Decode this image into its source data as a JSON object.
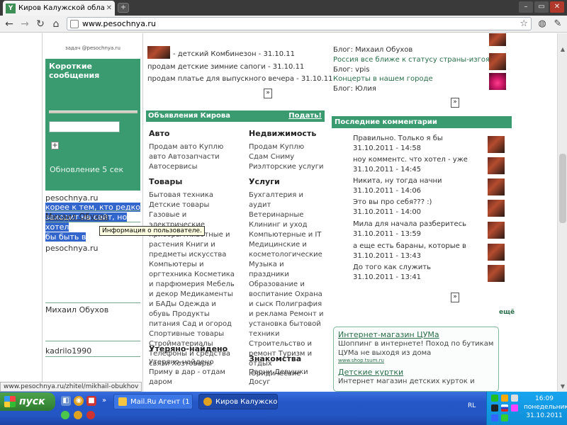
{
  "browser": {
    "tab_title": "Киров Калужской области го",
    "tab_favicon": "Y",
    "url": "www.pesochnya.ru",
    "status_url": "www.pesochnya.ru/zhitel/mikhail-obukhov"
  },
  "left": {
    "tiny_top": "задач @pesochnya.ru",
    "short_messages": {
      "title": "Короткие сообщения",
      "update_text": "Обновление 5 сек"
    },
    "site_name": "pesochnya.ru",
    "selected_lines": [
      "корее к тем, кто редко",
      "заходит на сайт, но хотел",
      "бы быть в"
    ],
    "users": [
      {
        "name": "Михаил Обухов"
      },
      {
        "name": "pesochnya.ru"
      },
      {
        "name": "Михаил Обухов"
      },
      {
        "name": "kadrilo1990"
      }
    ],
    "tooltip": "Информация о пользователе."
  },
  "middle": {
    "news": [
      "- детский Комбинезон - 31.10.11",
      "продам детские зимние сапоги - 31.10.11",
      "продам платье для выпускного вечера - 31.10.11"
    ],
    "pager": "»",
    "ads_header": "Объявления Кирова",
    "ads_post": "Подать!",
    "categories": {
      "auto": {
        "title": "Авто",
        "text": "Продам авто Куплю авто Автозапчасти Автосервисы"
      },
      "realty": {
        "title": "Недвижимость",
        "text": "Продам Куплю Сдам Сниму Риэлторские услуги"
      },
      "goods": {
        "title": "Товары",
        "text": "Бытовая техника Детские товары Газовые и электрические приборы Животные и растения Книги и предметы искусства Компьютеры и оргтехника Косметика и парфюмерия Мебель и декор Медикаменты и БАДы Одежда и обувь Продукты питания Сад и огород Спортивные товары Стройматериалы Телефоны и средства связи Хозтовары"
      },
      "services": {
        "title": "Услуги",
        "text": "Бухгалтерия и аудит Ветеринарные Клининг и уход Компьютерные и IT Медицинские и косметологические Музыка и праздники Образование и воспитание Охрана и сыск Полиграфия и реклама Ремонт и установка бытовой техники Строительство и ремонт Туризм и отдых Юридические"
      },
      "lost": {
        "title": "Утеряно-найдено",
        "text": "Утеряно-найдено Приму в дар - отдам даром"
      },
      "dating": {
        "title": "Знакомства",
        "text": "Парни Девушки Досуг"
      }
    }
  },
  "right": {
    "blog_lines": [
      {
        "text": "Блог: Михаил Обухов",
        "link": false
      },
      {
        "text": "Россия все ближе к статусу страны-изгоя",
        "link": true
      },
      {
        "text": "Блог: vpis",
        "link": false
      },
      {
        "text": "Концерты в нашем городе",
        "link": true
      },
      {
        "text": "Блог: Юлия",
        "link": false
      }
    ],
    "pager": "»",
    "comments_header": "Последние комментарии",
    "comments": [
      {
        "text": "Правильно. Только я бы",
        "date": "31.10.2011 - 14:58"
      },
      {
        "text": "ноу комментс. что хотел - уже",
        "date": "31.10.2011 - 14:45"
      },
      {
        "text": "Никита, ну тогда начни",
        "date": "31.10.2011 - 14:06"
      },
      {
        "text": "Это вы про себя??? :)",
        "date": "31.10.2011 - 14:00"
      },
      {
        "text": "Мила для начала разберитесь",
        "date": "31.10.2011 - 13:59"
      },
      {
        "text": "а еще есть бараны, которые в",
        "date": "31.10.2011 - 13:43"
      },
      {
        "text": "До того как служить",
        "date": "31.10.2011 - 13:41"
      }
    ],
    "comments_pager": "»",
    "more": "ещё",
    "ads": [
      {
        "title": "Интернет-магазин ЦУМа",
        "text": "Шоппинг в интернете! Поход по бутикам ЦУМа не выходя из дома",
        "url": "www.shop.tsum.ru"
      },
      {
        "title": "Детские куртки",
        "text": "Интернет магазин детских курток и",
        "url": ""
      }
    ]
  },
  "taskbar": {
    "start_label": "пуск",
    "buttons": [
      {
        "label": "Mail.Ru Агент (1 вкл..."
      },
      {
        "label": "Киров Калужской о..."
      }
    ],
    "lang": "RL",
    "time": "16:09",
    "day": "понедельник",
    "date": "31.10.2011"
  }
}
